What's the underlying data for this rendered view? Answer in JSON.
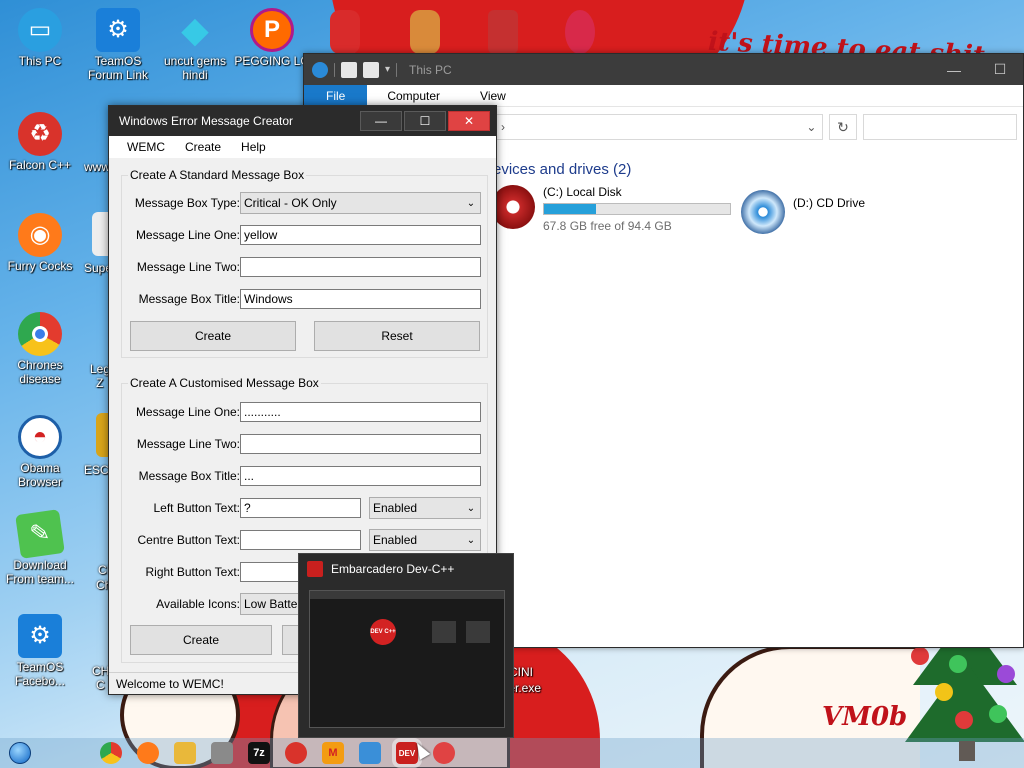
{
  "wallpaper": {
    "top_text": "it's time to eat shit",
    "bottom_text": "VM0b"
  },
  "desktop": {
    "icons": [
      {
        "label": "This PC",
        "icon": "monitor-icon",
        "color": "#2a9fe0"
      },
      {
        "label": "TeamOS Forum Link",
        "icon": "gear-icon",
        "color": "#1a7fd9"
      },
      {
        "label": "uncut gems hindi",
        "icon": "diamond-icon",
        "color": "#37c9e6"
      },
      {
        "label": "PEGGING LO",
        "icon": "p-logo-icon",
        "color": "#ff6a00"
      },
      {
        "label": "Falcon C++",
        "icon": "ornament-icon",
        "color": "#d9332b"
      },
      {
        "label": "www.",
        "icon": "partial-icon",
        "color": "#ccc"
      },
      {
        "label": "Furry Cocks",
        "icon": "firefox-icon",
        "color": "#ff7a1a"
      },
      {
        "label": "Supe",
        "icon": "partial-icon",
        "color": "#ccc"
      },
      {
        "label": "Chrones disease",
        "icon": "chrome-icon",
        "color": "#2fa84f"
      },
      {
        "label": "Leg",
        "icon": "partial-icon",
        "color": "#ccc"
      },
      {
        "label": "Z",
        "icon": "partial-icon",
        "color": "#ccc"
      },
      {
        "label": "Obama Browser",
        "icon": "obama-logo-icon",
        "color": "#1d5fa8"
      },
      {
        "label": "ESCA",
        "icon": "partial-icon",
        "color": "#ccc"
      },
      {
        "label": "Download From team...",
        "icon": "notepad-icon",
        "color": "#4fc24f"
      },
      {
        "label": "CI",
        "icon": "partial-icon",
        "color": "#ccc"
      },
      {
        "label": "Ch",
        "icon": "partial-icon",
        "color": "#ccc"
      },
      {
        "label": "TeamOS Facebo...",
        "icon": "gear-icon",
        "color": "#1a7fd9"
      },
      {
        "label": "CH",
        "icon": "partial-icon",
        "color": "#ccc"
      },
      {
        "label": "C",
        "icon": "partial-icon",
        "color": "#ccc"
      }
    ],
    "behind_thumb_text": [
      "CINI",
      "ter.exe"
    ]
  },
  "explorer": {
    "title": "This PC",
    "ribbon_tabs": [
      "File",
      "Computer",
      "View"
    ],
    "section_title": "evices and drives (2)",
    "drives": [
      {
        "name": "(C:) Local Disk",
        "free_text": "67.8 GB free of 94.4 GB",
        "used_fraction": 0.28
      },
      {
        "name": "(D:) CD Drive"
      }
    ],
    "window_controls": [
      "minimize",
      "maximize"
    ]
  },
  "wemc": {
    "title": "Windows Error Message Creator",
    "menu": [
      "WEMC",
      "Create",
      "Help"
    ],
    "standard": {
      "group_title": "Create A Standard Message Box",
      "type_label": "Message Box Type:",
      "type_value": "Critical - OK Only",
      "line1_label": "Message Line One:",
      "line1_value": "yellow",
      "line2_label": "Message Line Two:",
      "line2_value": "",
      "title_label": "Message Box Title:",
      "title_value": "Windows",
      "create_btn": "Create",
      "reset_btn": "Reset"
    },
    "custom": {
      "group_title": "Create A Customised Message Box",
      "line1_label": "Message Line One:",
      "line1_value": "...........",
      "line2_label": "Message Line Two:",
      "line2_value": "",
      "title_label": "Message Box Title:",
      "title_value": "...",
      "left_label": "Left Button Text:",
      "left_value": "?",
      "left_state": "Enabled",
      "centre_label": "Centre Button Text:",
      "centre_value": "",
      "centre_state": "Enabled",
      "right_label": "Right Button Text:",
      "right_value": "",
      "icons_label": "Available Icons:",
      "icons_value": "Low Battery",
      "create_btn": "Create"
    },
    "status": "Welcome to WEMC!"
  },
  "thumbnail": {
    "title": "Embarcadero Dev-C++",
    "logo_text": "DEV C++"
  },
  "taskbar": {
    "apps": [
      {
        "name": "chrome",
        "color": "#2fa84f",
        "glyph": ""
      },
      {
        "name": "firefox",
        "color": "#ff7a1a",
        "glyph": ""
      },
      {
        "name": "file-explorer",
        "color": "#e9b83a",
        "glyph": ""
      },
      {
        "name": "tool",
        "color": "#8a8a8a",
        "glyph": ""
      },
      {
        "name": "7zip",
        "color": "#111111",
        "glyph": "7z"
      },
      {
        "name": "ornament",
        "color": "#d9332b",
        "glyph": ""
      },
      {
        "name": "m-app",
        "color": "#f39c12",
        "glyph": "M"
      },
      {
        "name": "window-app",
        "color": "#3a8fd8",
        "glyph": ""
      },
      {
        "name": "devcpp",
        "color": "#c9201e",
        "glyph": "DEV"
      },
      {
        "name": "red-app",
        "color": "#e04343",
        "glyph": ""
      }
    ]
  }
}
